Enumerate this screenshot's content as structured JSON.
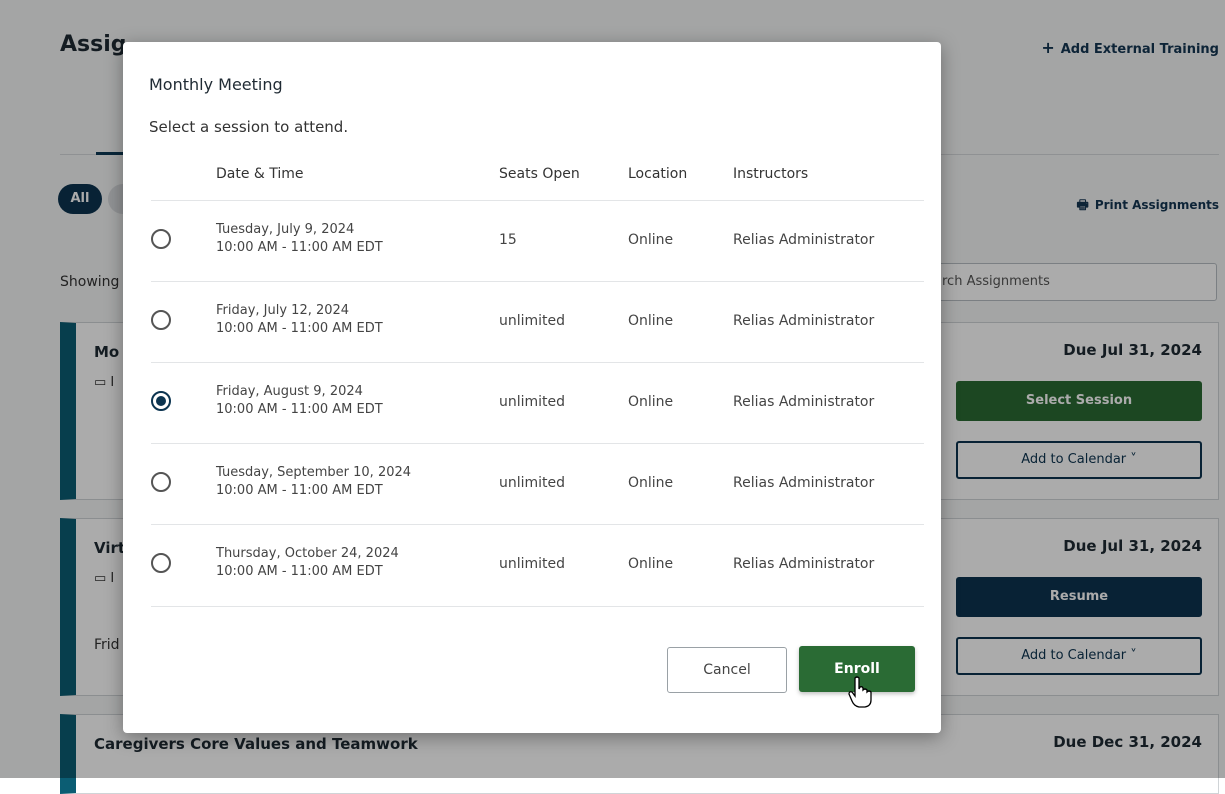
{
  "background": {
    "page_title": "Assig",
    "add_external": "Add External Training",
    "add_external_icon": "plus-icon",
    "filter_all": "All",
    "print": "Print Assignments",
    "print_icon": "printer-icon",
    "showing": "Showing",
    "search_placeholder": "rch Assignments",
    "cards": [
      {
        "title": "Mo",
        "due": "Due Jul 31, 2024",
        "primary": "Select Session",
        "secondary": "Add to Calendar  ˅",
        "calendar_icon": "calendar-icon"
      },
      {
        "title": "Virt",
        "due": "Due Jul 31, 2024",
        "primary": "Resume",
        "secondary": "Add to Calendar  ˅",
        "sub": "Frid",
        "calendar_icon": "calendar-icon"
      },
      {
        "title": "Caregivers Core Values and Teamwork",
        "due": "Due Dec 31, 2024"
      }
    ]
  },
  "modal": {
    "title": "Monthly Meeting",
    "subtitle": "Select a session to attend.",
    "columns": [
      "Date & Time",
      "Seats Open",
      "Location",
      "Instructors"
    ],
    "sessions": [
      {
        "date": "Tuesday, July 9, 2024",
        "time": "10:00 AM - 11:00 AM EDT",
        "seats": "15",
        "location": "Online",
        "instructor": "Relias Administrator",
        "selected": false
      },
      {
        "date": "Friday, July 12, 2024",
        "time": "10:00 AM - 11:00 AM EDT",
        "seats": "unlimited",
        "location": "Online",
        "instructor": "Relias Administrator",
        "selected": false
      },
      {
        "date": "Friday, August 9, 2024",
        "time": "10:00 AM - 11:00 AM EDT",
        "seats": "unlimited",
        "location": "Online",
        "instructor": "Relias Administrator",
        "selected": true
      },
      {
        "date": "Tuesday, September 10, 2024",
        "time": "10:00 AM - 11:00 AM EDT",
        "seats": "unlimited",
        "location": "Online",
        "instructor": "Relias Administrator",
        "selected": false
      },
      {
        "date": "Thursday, October 24, 2024",
        "time": "10:00 AM - 11:00 AM EDT",
        "seats": "unlimited",
        "location": "Online",
        "instructor": "Relias Administrator",
        "selected": false
      }
    ],
    "cancel_label": "Cancel",
    "enroll_label": "Enroll"
  },
  "colors": {
    "primary_green": "#2a6b34",
    "navy": "#0c3450",
    "card_accent": "#0b5d73"
  }
}
